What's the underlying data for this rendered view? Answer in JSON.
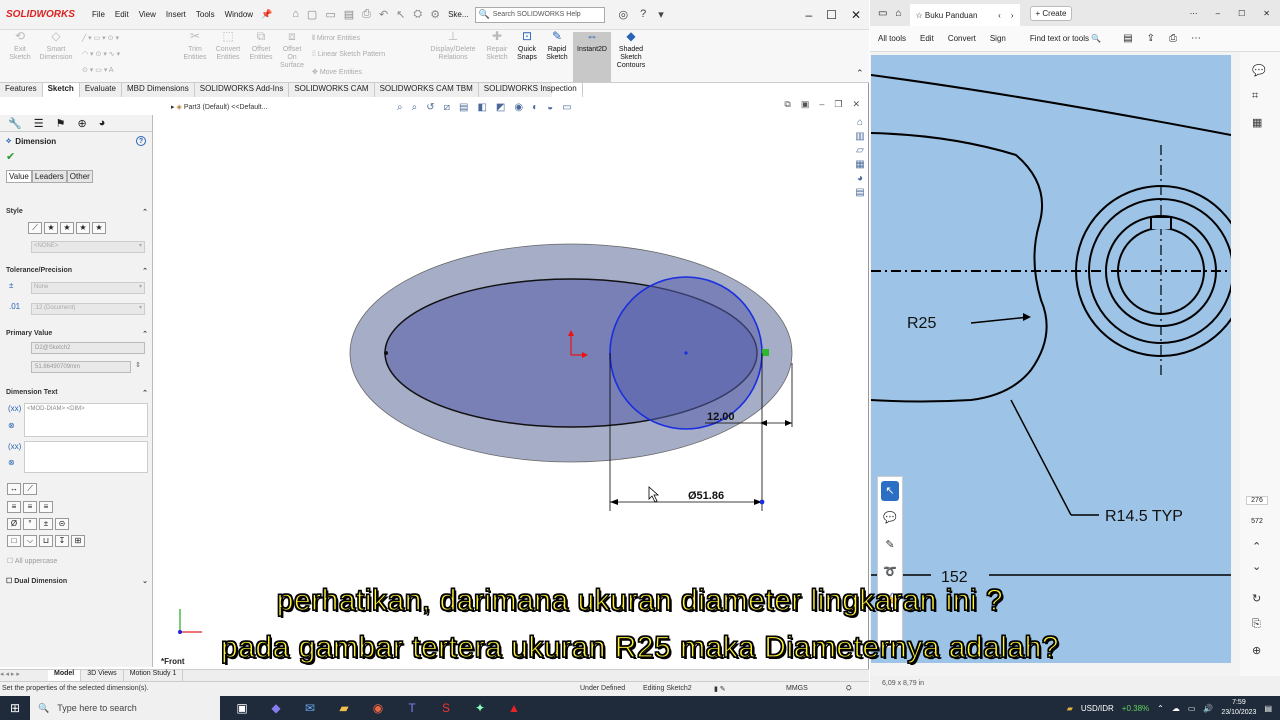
{
  "solidworks": {
    "logo": "SOLIDWORKS",
    "menu": [
      "File",
      "Edit",
      "View",
      "Insert",
      "Tools",
      "Window"
    ],
    "ske_label": "Ske...",
    "search_placeholder": "Search SOLIDWORKS Help",
    "ribbon": {
      "exit_sketch": "Exit Sketch",
      "smart_dimension": "Smart Dimension",
      "trim_entities": "Trim Entities",
      "convert_entities": "Convert Entities",
      "offset_entities": "Offset Entities",
      "offset_on_surface": "Offset On Surface",
      "mirror_entities": "Mirror Entities",
      "linear_sketch_pattern": "Linear Sketch Pattern",
      "move_entities": "Move Entities",
      "display_delete_relations": "Display/Delete Relations",
      "repair_sketch": "Repair Sketch",
      "quick_snaps": "Quick Snaps",
      "rapid_sketch": "Rapid Sketch",
      "instant2d": "Instant2D",
      "shaded_sketch_contours": "Shaded Sketch Contours"
    },
    "tabs": [
      "Features",
      "Sketch",
      "Evaluate",
      "MBD Dimensions",
      "SOLIDWORKS Add-Ins",
      "SOLIDWORKS CAM",
      "SOLIDWORKS CAM TBM",
      "SOLIDWORKS Inspection"
    ],
    "selected_tab": "Sketch",
    "property_manager": {
      "title": "Dimension",
      "tabs": [
        "Value",
        "Leaders",
        "Other"
      ],
      "style_label": "Style",
      "style_dropdown": "<NONE>",
      "tolerance_label": "Tolerance/Precision",
      "tolerance_dropdown": "None",
      "precision_dropdown": ".12 (Document)",
      "primary_value_label": "Primary Value",
      "primary_name": "D2@Sketch2",
      "primary_value": "51.86490709mm",
      "dimension_text_label": "Dimension Text",
      "dimension_text": "<MOD-DIAM> <DIM>",
      "all_uppercase": "All uppercase",
      "dual_dimension": "Dual Dimension"
    },
    "breadcrumb": "Part3 (Default) <<Default...",
    "dim_linear": "12.00",
    "dim_diameter": "Ø51.86",
    "view_label": "*Front",
    "bottom_tabs": [
      "Model",
      "3D Views",
      "Motion Study 1"
    ],
    "status": {
      "hint": "Set the properties of the selected dimension(s).",
      "defined": "Under Defined",
      "editing": "Editing Sketch2",
      "units": "MMGS"
    }
  },
  "pdf_viewer": {
    "tab_title": "Buku Panduan",
    "new_tab": "Create",
    "toolbar": [
      "All tools",
      "Edit",
      "Convert",
      "Sign",
      "Find text or tools"
    ],
    "drawing_labels": [
      "R25",
      "R14.5 TYP",
      "152"
    ],
    "page_current": "276",
    "page_total": "572",
    "page_size": "6,09 x 8,79 in"
  },
  "subtitles": [
    "perhatikan, darimana ukuran diameter lingkaran ini ?",
    "pada gambar tertera ukuran R25 maka Diameternya adalah?"
  ],
  "taskbar": {
    "search_placeholder": "Type here to search",
    "currency": "USD/IDR",
    "currency_change": "+0.38%",
    "time": "7:59",
    "date": "23/10/2023"
  },
  "colors": {
    "ellipse_fill": "#a6adc6",
    "inner_fill": "#7880b5",
    "circle_stroke": "#1a2ee0",
    "subtitle": "#fff23a",
    "pdf_blueprint": "#9dc4e6"
  }
}
